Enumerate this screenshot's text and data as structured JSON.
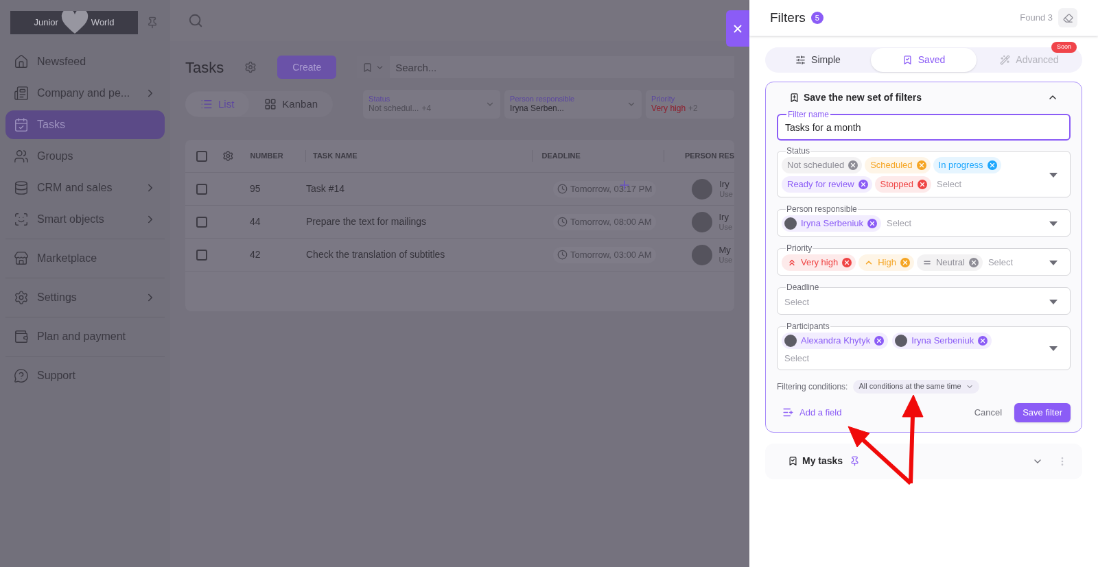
{
  "sidebar": {
    "logo": {
      "left": "Junior",
      "right": "World"
    },
    "sections": [
      {
        "items": [
          {
            "label": "Newsfeed",
            "has_submenu": false,
            "selected": false
          },
          {
            "label": "Company and pe...",
            "has_submenu": true,
            "selected": false
          },
          {
            "label": "Tasks",
            "has_submenu": false,
            "selected": true
          },
          {
            "label": "Groups",
            "has_submenu": false,
            "selected": false
          },
          {
            "label": "CRM and sales",
            "has_submenu": true,
            "selected": false
          },
          {
            "label": "Smart objects",
            "has_submenu": true,
            "selected": false
          }
        ]
      },
      {
        "items": [
          {
            "label": "Marketplace",
            "has_submenu": false,
            "selected": false
          }
        ]
      },
      {
        "items": [
          {
            "label": "Settings",
            "has_submenu": true,
            "selected": false
          }
        ]
      },
      {
        "items": [
          {
            "label": "Plan and payment",
            "has_submenu": false,
            "selected": false
          }
        ]
      },
      {
        "items": [
          {
            "label": "Support",
            "has_submenu": false,
            "selected": false
          }
        ]
      }
    ]
  },
  "page": {
    "title": "Tasks",
    "create_button": "Create",
    "search": {
      "placeholder": "Search..."
    },
    "views": [
      {
        "label": "List",
        "selected": true
      },
      {
        "label": "Kanban",
        "selected": false
      }
    ],
    "filters": [
      {
        "label": "Status",
        "value": "Not schedul...",
        "extra": "+4",
        "color": "#4e4c56"
      },
      {
        "label": "Person responsible",
        "value": "Iryna Serben...",
        "color": "#2f2d35"
      },
      {
        "label": "Priority",
        "value": "Very high",
        "extra": "+2",
        "color": "#8f1f2d"
      }
    ]
  },
  "table": {
    "all_checked": false,
    "columns": [
      "NUMBER",
      "TASK NAME",
      "DEADLINE",
      "PERSON RES"
    ],
    "rows": [
      {
        "checked": false,
        "number": "95",
        "task": "Task #14",
        "deadline": "Tomorrow, 03:17 PM",
        "person": "Iry",
        "person_sub": "Use"
      },
      {
        "checked": false,
        "number": "44",
        "task": "Prepare the text for mailings",
        "deadline": "Tomorrow, 08:00 AM",
        "person": "Iry",
        "person_sub": "Use"
      },
      {
        "checked": false,
        "number": "42",
        "task": "Check the translation of subtitles",
        "deadline": "Tomorrow, 03:00 AM",
        "person": "My",
        "person_sub": "Use"
      }
    ]
  },
  "filters_panel": {
    "title": "Filters",
    "count": "5",
    "found": "Found 3",
    "tabs": [
      {
        "label": "Simple",
        "selected": false,
        "disabled": false
      },
      {
        "label": "Saved",
        "selected": true,
        "disabled": false
      },
      {
        "label": "Advanced",
        "selected": false,
        "disabled": true,
        "badge": "Soon"
      }
    ],
    "new_set": {
      "title": "Save the new set of filters",
      "expanded": true,
      "name_field": {
        "label": "Filter name",
        "value": "Tasks for a month"
      },
      "fields": [
        {
          "label": "Status",
          "kind": "tags",
          "placeholder": "Select",
          "values": [
            {
              "label": "Not scheduled",
              "color": "#8e8d96"
            },
            {
              "label": "Scheduled",
              "color": "#f5a524"
            },
            {
              "label": "In progress",
              "color": "#1ea7fd"
            },
            {
              "label": "Ready for review",
              "color": "#8b5cf6"
            },
            {
              "label": "Stopped",
              "color": "#ef4444"
            }
          ]
        },
        {
          "label": "Person responsible",
          "kind": "people",
          "placeholder": "Select",
          "values": [
            {
              "label": "Iryna Serbeniuk"
            }
          ]
        },
        {
          "label": "Priority",
          "kind": "priority",
          "placeholder": "Select",
          "values": [
            {
              "label": "Very high",
              "kind": "very_high",
              "color": "#ef4444"
            },
            {
              "label": "High",
              "kind": "high",
              "color": "#f5a524"
            },
            {
              "label": "Neutral",
              "kind": "neutral",
              "color": "#8e8d96"
            }
          ]
        },
        {
          "label": "Deadline",
          "kind": "plain",
          "placeholder": "Select"
        },
        {
          "label": "Participants",
          "kind": "people_stacked",
          "placeholder": "Select",
          "values": [
            {
              "label": "Alexandra Khytyk"
            },
            {
              "label": "Iryna Serbeniuk"
            }
          ]
        }
      ],
      "conditions_label": "Filtering conditions:",
      "conditions_value": "All conditions at the same time",
      "add_field": "Add a field",
      "cancel": "Cancel",
      "save": "Save filter"
    },
    "saved": [
      {
        "title": "My tasks",
        "pinned": true,
        "expanded": false
      }
    ]
  }
}
